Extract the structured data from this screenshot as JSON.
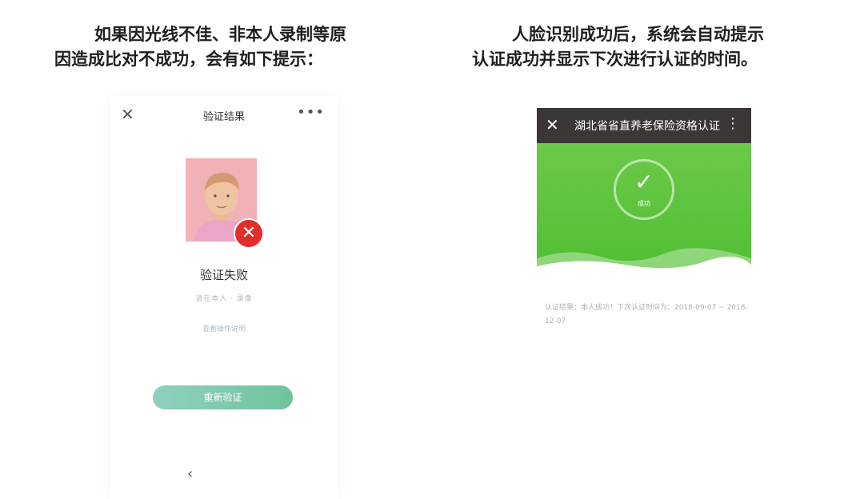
{
  "captions": {
    "left": [
      "如果因光线不佳、非本人录制等原",
      "因造成比对不成功，会有如下提示："
    ],
    "right": [
      "人脸识别成功后，系统会自动提示",
      "认证成功并显示下次进行认证的时间。"
    ]
  },
  "left_screen": {
    "nav": {
      "close_icon": "close-icon",
      "title": "验证结果",
      "more_icon": "more-icon"
    },
    "status": {
      "title": "验证失败",
      "detail": "请在本人 · 录像",
      "link": "查看操作说明"
    },
    "retry_button": "重新验证",
    "back_icon": "back-icon"
  },
  "right_screen": {
    "nav": {
      "close_icon": "close-icon",
      "title": "湖北省省直养老保险资格认证",
      "menu_icon": "menu-icon"
    },
    "success": {
      "label": "成功"
    },
    "result": {
      "text": "认证结果：本人成功！下次认证时间为：2018-09-07 ~ 2018-12-07"
    }
  },
  "colors": {
    "green": "#5ec23f",
    "nav_dark": "#3b3736",
    "fail_red": "#e22d2d",
    "retry_btn": "#7fcaa8"
  }
}
